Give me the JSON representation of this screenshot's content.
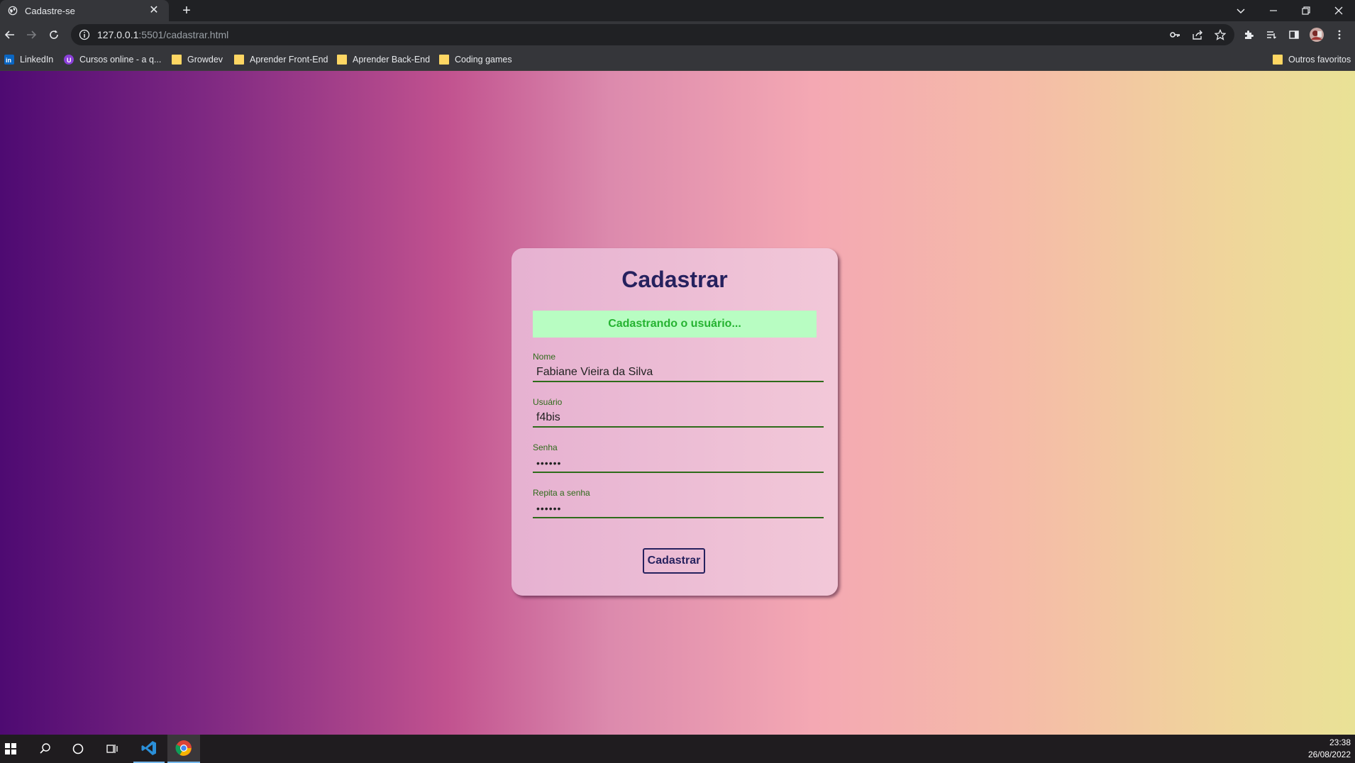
{
  "browser": {
    "tab_title": "Cadastre-se",
    "url_host": "127.0.0.1",
    "url_rest": ":5501/cadastrar.html",
    "bookmarks": [
      {
        "label": "LinkedIn",
        "icon": "linkedin-icon"
      },
      {
        "label": "Cursos online - a q...",
        "icon": "course-site-icon"
      },
      {
        "label": "Growdev",
        "icon": "folder-icon"
      },
      {
        "label": "Aprender Front-End",
        "icon": "folder-icon"
      },
      {
        "label": "Aprender Back-End",
        "icon": "folder-icon"
      },
      {
        "label": "Coding games",
        "icon": "folder-icon"
      }
    ],
    "other_bookmarks": "Outros favoritos"
  },
  "form": {
    "title": "Cadastrar",
    "status_message": "Cadastrando o usuário...",
    "fields": [
      {
        "label": "Nome",
        "value": "Fabiane Vieira da Silva",
        "type": "text"
      },
      {
        "label": "Usuário",
        "value": "f4bis",
        "type": "text"
      },
      {
        "label": "Senha",
        "value": "••••••",
        "type": "password"
      },
      {
        "label": "Repita a senha",
        "value": "••••••",
        "type": "password"
      }
    ],
    "submit_label": "Cadastrar"
  },
  "taskbar": {
    "time": "23:38",
    "date": "26/08/2022"
  },
  "colors": {
    "title": "#26215e",
    "status_bg": "#b8fdc2",
    "status_text": "#25b331",
    "field_accent": "#2e6b1a"
  }
}
